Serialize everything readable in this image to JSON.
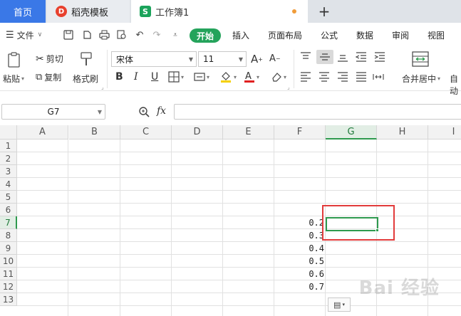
{
  "tabs": {
    "home": "首页",
    "template": "稻壳模板",
    "workbook": "工作簿1",
    "add": "+"
  },
  "menu": {
    "file": "文件",
    "tabs": [
      "开始",
      "插入",
      "页面布局",
      "公式",
      "数据",
      "审阅",
      "视图"
    ]
  },
  "ribbon": {
    "paste": "粘贴",
    "cut": "剪切",
    "copy": "复制",
    "format_painter": "格式刷",
    "font_name": "宋体",
    "font_size": "11",
    "bold": "B",
    "italic": "I",
    "underline": "U",
    "merge_center": "合并居中",
    "auto_wrap": "自动"
  },
  "formula_bar": {
    "name_box": "G7",
    "fx": "fx",
    "content": ""
  },
  "grid": {
    "columns": [
      "A",
      "B",
      "C",
      "D",
      "E",
      "F",
      "G",
      "H",
      "I"
    ],
    "rows": [
      "1",
      "2",
      "3",
      "4",
      "5",
      "6",
      "7",
      "8",
      "9",
      "10",
      "11",
      "12",
      "13"
    ],
    "selected_column": "G",
    "selected_row": "7",
    "f_values": [
      {
        "row": 7,
        "value": "0.2"
      },
      {
        "row": 8,
        "value": "0.3"
      },
      {
        "row": 9,
        "value": "0.4"
      },
      {
        "row": 10,
        "value": "0.5"
      },
      {
        "row": 11,
        "value": "0.6"
      },
      {
        "row": 12,
        "value": "0.7"
      }
    ]
  },
  "colors": {
    "accent_green": "#24a35b",
    "home_tab_blue": "#3a78e7",
    "highlight_red": "#e23b3b"
  },
  "watermark": "Bai 经验"
}
